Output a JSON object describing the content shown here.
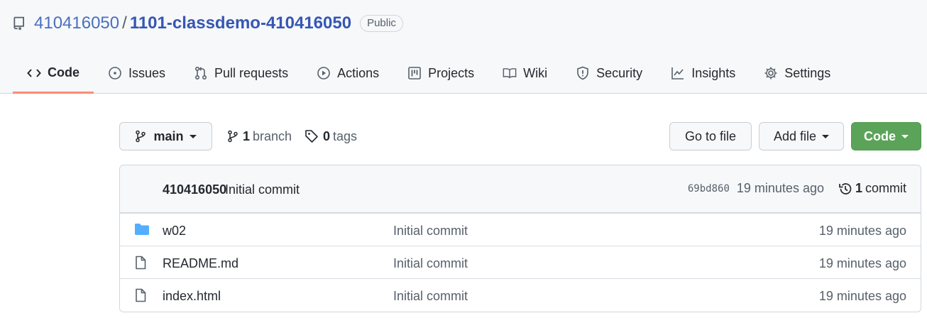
{
  "repo": {
    "owner": "410416050",
    "separator": "/",
    "name": "1101-classdemo-410416050",
    "visibility": "Public"
  },
  "tabs": [
    {
      "label": "Code",
      "icon": "code-icon",
      "active": true
    },
    {
      "label": "Issues",
      "icon": "issue-icon"
    },
    {
      "label": "Pull requests",
      "icon": "pull-request-icon"
    },
    {
      "label": "Actions",
      "icon": "play-icon"
    },
    {
      "label": "Projects",
      "icon": "project-board-icon"
    },
    {
      "label": "Wiki",
      "icon": "book-icon"
    },
    {
      "label": "Security",
      "icon": "shield-icon"
    },
    {
      "label": "Insights",
      "icon": "graph-icon"
    },
    {
      "label": "Settings",
      "icon": "gear-icon"
    }
  ],
  "toolbar": {
    "branch_selected": "main",
    "branch_count": "1",
    "branch_label": "branch",
    "tag_count": "0",
    "tag_label": "tags",
    "goto_file": "Go to file",
    "add_file": "Add file",
    "code": "Code"
  },
  "latest_commit": {
    "author": "410416050",
    "message": "Initial commit",
    "sha": "69bd860",
    "age": "19 minutes ago",
    "commit_count": "1",
    "commit_label": "commit"
  },
  "files": [
    {
      "name": "w02",
      "type": "folder",
      "commit": "Initial commit",
      "age": "19 minutes ago"
    },
    {
      "name": "README.md",
      "type": "file",
      "commit": "Initial commit",
      "age": "19 minutes ago"
    },
    {
      "name": "index.html",
      "type": "file",
      "commit": "Initial commit",
      "age": "19 minutes ago"
    }
  ],
  "colors": {
    "accent_tab_underline": "#fd8c73",
    "code_button": "#5ca35a",
    "folder_icon": "#54aeff",
    "link": "#3756b3"
  }
}
